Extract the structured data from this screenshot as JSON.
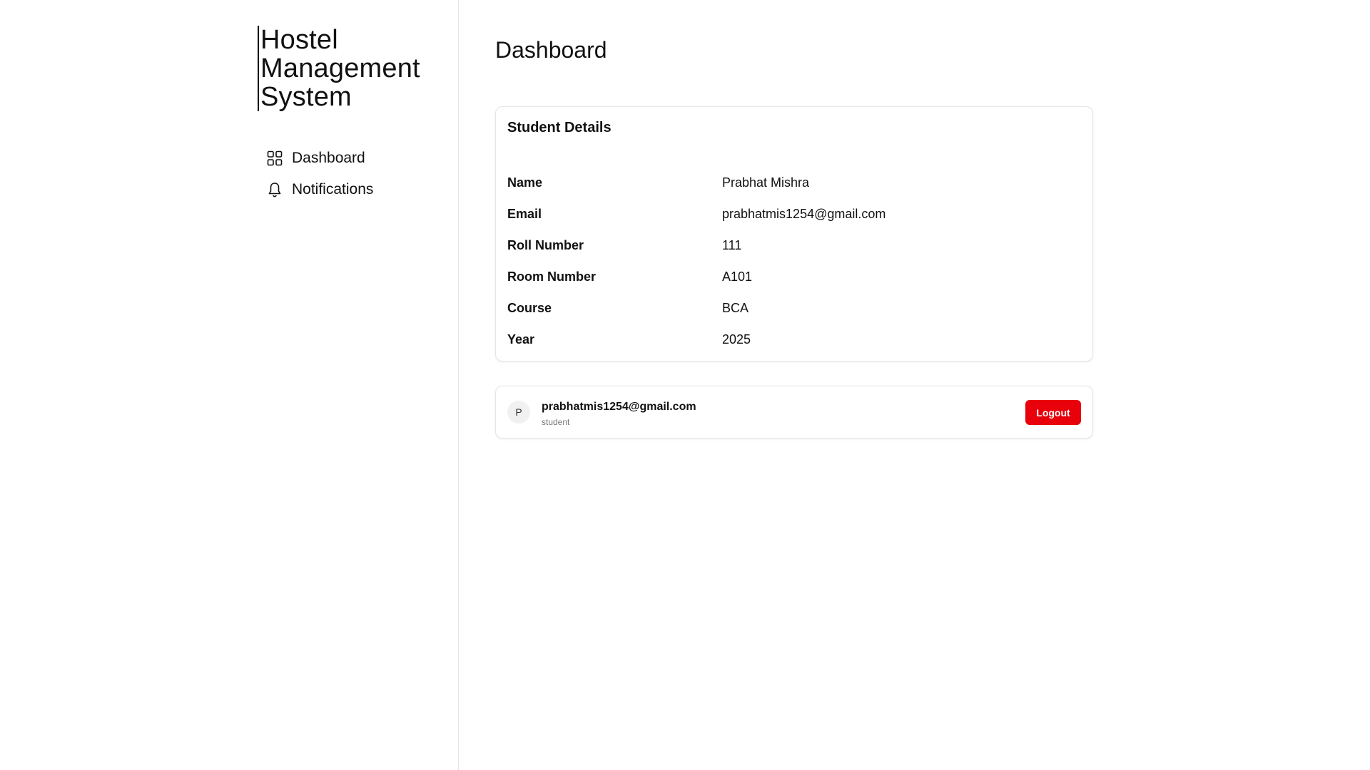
{
  "sidebar": {
    "brand": "Hostel Management System",
    "nav": [
      {
        "label": "Dashboard",
        "icon": "grid-icon"
      },
      {
        "label": "Notifications",
        "icon": "bell-icon"
      }
    ]
  },
  "main": {
    "title": "Dashboard",
    "details": {
      "title": "Student Details",
      "rows": [
        {
          "label": "Name",
          "value": "Prabhat Mishra"
        },
        {
          "label": "Email",
          "value": "prabhatmis1254@gmail.com"
        },
        {
          "label": "Roll Number",
          "value": "111"
        },
        {
          "label": "Room Number",
          "value": "A101"
        },
        {
          "label": "Course",
          "value": "BCA"
        },
        {
          "label": "Year",
          "value": "2025"
        }
      ]
    },
    "user": {
      "avatar_initial": "P",
      "email": "prabhatmis1254@gmail.com",
      "role": "student",
      "logout_label": "Logout"
    }
  },
  "colors": {
    "accent": "#e8000b",
    "border": "#e6e6e6",
    "text": "#111111"
  }
}
